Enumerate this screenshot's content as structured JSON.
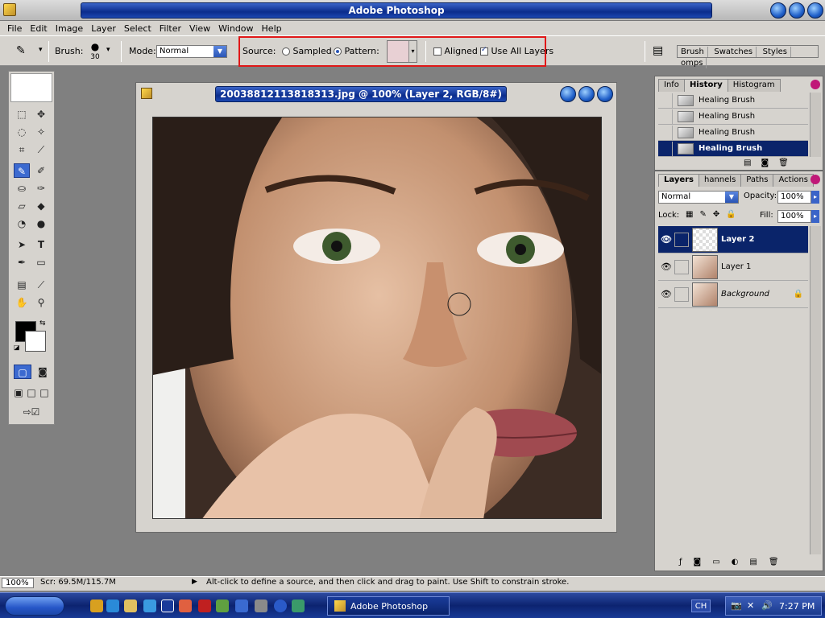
{
  "app": {
    "title": "Adobe Photoshop"
  },
  "menu": [
    "File",
    "Edit",
    "Image",
    "Layer",
    "Select",
    "Filter",
    "View",
    "Window",
    "Help"
  ],
  "options": {
    "brush_label": "Brush:",
    "brush_size": "30",
    "mode_label": "Mode:",
    "mode_value": "Normal",
    "source_label": "Source:",
    "sampled_label": "Sampled",
    "pattern_label": "Pattern:",
    "aligned_label": "Aligned",
    "use_all_layers_label": "Use All Layers",
    "palette_tabs": [
      "Brush",
      "Swatches",
      "Styles",
      "omps"
    ]
  },
  "document": {
    "title": "20038812113818313.jpg @ 100% (Layer 2, RGB/8#)"
  },
  "history": {
    "tabs": [
      "Info",
      "History",
      "Histogram"
    ],
    "items": [
      "Healing Brush",
      "Healing Brush",
      "Healing Brush",
      "Healing Brush"
    ]
  },
  "layers": {
    "tabs": [
      "Layers",
      "hannels",
      "Paths",
      "Actions"
    ],
    "blend_mode": "Normal",
    "opacity_label": "Opacity:",
    "opacity_value": "100%",
    "lock_label": "Lock:",
    "fill_label": "Fill:",
    "fill_value": "100%",
    "items": [
      "Layer 2",
      "Layer 1",
      "Background"
    ]
  },
  "status": {
    "zoom": "100%",
    "scratch": "Scr: 69.5M/115.7M",
    "hint": "Alt-click to define a source, and then click and drag to paint. Use Shift to constrain stroke."
  },
  "taskbar": {
    "task_label": "Adobe Photoshop",
    "lang": "CH",
    "time": "7:27 PM"
  },
  "colors": {
    "accent": "#0a246a",
    "highlight_box": "#e01818"
  }
}
